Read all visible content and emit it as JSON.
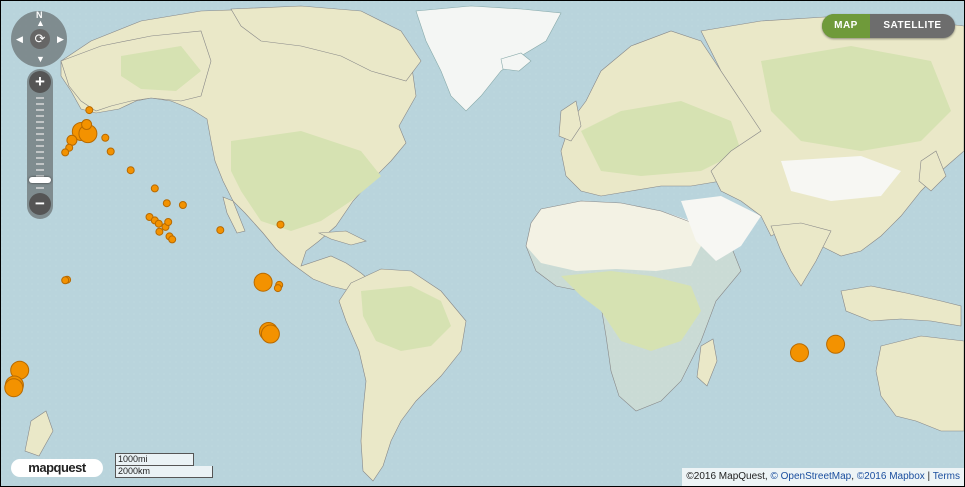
{
  "controls": {
    "north": "N",
    "rotate_glyph": "⟳",
    "zoom_in": "+",
    "zoom_out": "−",
    "pan_up": "▲",
    "pan_down": "▼",
    "pan_left": "◀",
    "pan_right": "▶"
  },
  "map_type": {
    "active": "MAP",
    "map_label": "MAP",
    "satellite_label": "SATELLITE",
    "active_color": "#6f9a3a"
  },
  "logo": "mapquest",
  "scale": {
    "miles": "1000mi",
    "kilometers": "2000km"
  },
  "attribution": {
    "mapquest": "©2016 MapQuest, ",
    "osm": "© OpenStreetMap",
    "sep1": ", ",
    "mapbox": "©2016 Mapbox",
    "sep2": " | ",
    "terms": "Terms"
  },
  "colors": {
    "water": "#b9d4dc",
    "land": "#eae8c8",
    "vegetation": "#d6e2b2",
    "desert": "#f7f7f3",
    "marker": "#f39200"
  },
  "earthquake_markers": [
    {
      "lat": 61.2,
      "lon": -150.0,
      "size": "large"
    },
    {
      "lat": 60.8,
      "lon": -147.5,
      "size": "large"
    },
    {
      "lat": 59.5,
      "lon": -153.5,
      "size": "medium"
    },
    {
      "lat": 58.0,
      "lon": -154.5,
      "size": "small"
    },
    {
      "lat": 57.0,
      "lon": -156.0,
      "size": "small"
    },
    {
      "lat": 62.5,
      "lon": -148.0,
      "size": "medium"
    },
    {
      "lat": 60.0,
      "lon": -141.0,
      "size": "small"
    },
    {
      "lat": 65.0,
      "lon": -147.0,
      "size": "small"
    },
    {
      "lat": 57.2,
      "lon": -139.0,
      "size": "small"
    },
    {
      "lat": 53.0,
      "lon": -131.5,
      "size": "small"
    },
    {
      "lat": 48.5,
      "lon": -122.5,
      "size": "small"
    },
    {
      "lat": 44.5,
      "lon": -118.0,
      "size": "small"
    },
    {
      "lat": 40.5,
      "lon": -124.5,
      "size": "small"
    },
    {
      "lat": 39.5,
      "lon": -122.5,
      "size": "small"
    },
    {
      "lat": 38.5,
      "lon": -121.0,
      "size": "small"
    },
    {
      "lat": 37.5,
      "lon": -118.5,
      "size": "small"
    },
    {
      "lat": 36.0,
      "lon": -120.8,
      "size": "small"
    },
    {
      "lat": 34.5,
      "lon": -117.0,
      "size": "small"
    },
    {
      "lat": 33.5,
      "lon": -116.0,
      "size": "small"
    },
    {
      "lat": 39.0,
      "lon": -117.5,
      "size": "small"
    },
    {
      "lat": 36.5,
      "lon": -98.0,
      "size": "small"
    },
    {
      "lat": 44.0,
      "lon": -112.0,
      "size": "small"
    },
    {
      "lat": 38.2,
      "lon": -75.5,
      "size": "small"
    },
    {
      "lat": 18.5,
      "lon": -82.0,
      "size": "large"
    },
    {
      "lat": 17.5,
      "lon": -76.0,
      "size": "small"
    },
    {
      "lat": 16.3,
      "lon": -76.5,
      "size": "small"
    },
    {
      "lat": 19.4,
      "lon": -155.3,
      "size": "small"
    },
    {
      "lat": 19.2,
      "lon": -156.0,
      "size": "small"
    },
    {
      "lat": -0.5,
      "lon": -80.0,
      "size": "large"
    },
    {
      "lat": -1.5,
      "lon": -79.3,
      "size": "large"
    },
    {
      "lat": -15.5,
      "lon": -173.0,
      "size": "large"
    },
    {
      "lat": -21.0,
      "lon": -175.0,
      "size": "large"
    },
    {
      "lat": -22.0,
      "lon": -175.2,
      "size": "large"
    },
    {
      "lat": -8.8,
      "lon": 118.5,
      "size": "large"
    },
    {
      "lat": -5.5,
      "lon": 132.0,
      "size": "large"
    }
  ]
}
